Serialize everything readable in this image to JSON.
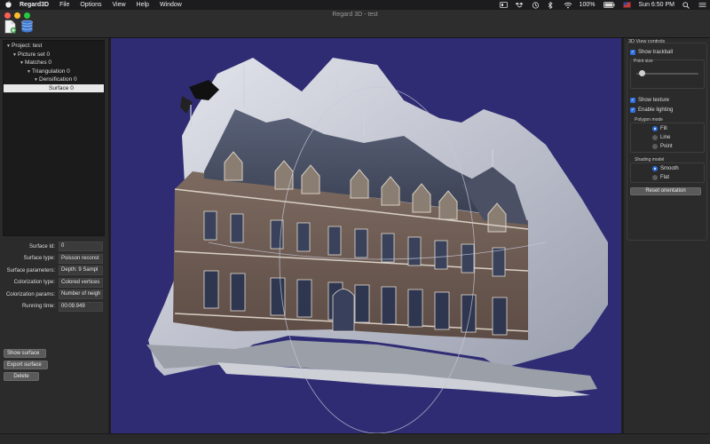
{
  "menubar": {
    "app_name": "Regard3D",
    "items": [
      "File",
      "Options",
      "View",
      "Help",
      "Window"
    ],
    "battery": "100%",
    "clock": "Sun 6:50 PM"
  },
  "window": {
    "title": "Regard 3D - test"
  },
  "tree": {
    "items": [
      {
        "label": "Project: test"
      },
      {
        "label": "Picture set 0"
      },
      {
        "label": "Matches 0"
      },
      {
        "label": "Triangulation 0"
      },
      {
        "label": "Densification 0"
      },
      {
        "label": "Surface 0"
      }
    ]
  },
  "properties": {
    "rows": [
      {
        "label": "Surface Id:",
        "value": "0"
      },
      {
        "label": "Surface type:",
        "value": "Poisson reconst"
      },
      {
        "label": "Surface parameters:",
        "value": "Depth: 9 Sampl"
      },
      {
        "label": "Colorization type:",
        "value": "Colored vertices"
      },
      {
        "label": "Colorization params:",
        "value": "Number of neigh"
      },
      {
        "label": "Running time:",
        "value": "00:09.949"
      }
    ]
  },
  "buttons": {
    "show_surface": "Show surface",
    "export_surface": "Export surface",
    "delete": "Delete"
  },
  "controls": {
    "group_title": "3D View controls",
    "show_trackball": "Show trackball",
    "point_size_title": "Point size",
    "point_size_level": 0.05,
    "show_texture": "Show texture",
    "enable_lighting": "Enable lighting",
    "polygon_mode_title": "Polygon mode",
    "polygon_modes": [
      "Fill",
      "Line",
      "Point"
    ],
    "polygon_selected": "Fill",
    "shading_model_title": "Shading model",
    "shading_models": [
      "Smooth",
      "Flat"
    ],
    "shading_selected": "Smooth",
    "reset_orientation": "Reset orientation"
  },
  "colors": {
    "viewport_bg": "#2f2c74",
    "accent": "#2f6fe0"
  }
}
